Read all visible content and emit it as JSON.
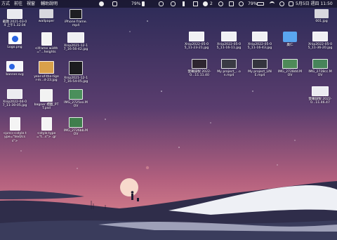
{
  "menubar": {
    "left": [
      "方式",
      "前往",
      "視窗",
      "輔助說明"
    ],
    "battery_a": "79%",
    "battery_b": "79%",
    "notify_count": "2",
    "datetime": "5月5日 週四 11:50"
  },
  "desktop": {
    "files": [
      {
        "label": "截圖 2021-03-04 上午1.32.04",
        "kind": "shot"
      },
      {
        "label": "wallpaper",
        "kind": "blank"
      },
      {
        "label": "iPhone frame.mp4",
        "kind": "phone"
      },
      {
        "label": "Logo.png",
        "kind": "logo"
      },
      {
        "label": "<iframe width=\"...heights",
        "kind": "doc"
      },
      {
        "label": "Xnip2021-12-17_16-56-42.jpg",
        "kind": "shot"
      },
      {
        "label": "banner.svg",
        "kind": "banner"
      },
      {
        "label": "year-of-the-tiger-m...d-23.jpg",
        "kind": "tiger"
      },
      {
        "label": "Xnip2021-12-17_16-54-05.jpg",
        "kind": "shot"
      },
      {
        "label": "Xnip2022-04-07_11-30-05.jpg",
        "kind": "shot"
      },
      {
        "label": "banner 標籤_PTT.psd",
        "kind": "doc"
      },
      {
        "label": "IMG_2725xx.MOV",
        "kind": "video"
      },
      {
        "label": "<pre><style type=\"text/css\">",
        "kind": "doc"
      },
      {
        "label": "<style type=\"t...s\"> .gr",
        "kind": "doc"
      },
      {
        "label": "IMG_2726bb.MOV",
        "kind": "video"
      },
      {
        "label": "001.jpg",
        "kind": "blank"
      },
      {
        "label": "Xnip2022-05-05_11-23-21.jpg",
        "kind": "shot"
      },
      {
        "label": "Xnip2022-05-05_11-16-11.jpg",
        "kind": "shot"
      },
      {
        "label": "Xnip2022-05-05_11-16-43.jpg",
        "kind": "shot"
      },
      {
        "label": "廣仁",
        "kind": "folder"
      },
      {
        "label": "Xnip2022-05-05_11-36-20.jpg",
        "kind": "shot"
      },
      {
        "label": "螢幕錄製 2022-0...11.11.40",
        "kind": "movie"
      },
      {
        "label": "My project_...on.mp4",
        "kind": "movie"
      },
      {
        "label": "My project_LINE.mp4",
        "kind": "movie"
      },
      {
        "label": "IMG_2728dd.MOV",
        "kind": "video"
      },
      {
        "label": "IMG_2728cc.MOV",
        "kind": "video"
      },
      {
        "label": "螢幕錄製 2022-0...11.46.47",
        "kind": "shot"
      }
    ]
  },
  "colors": {
    "sky_top": "#2c2b57",
    "sky_mid": "#8a4f78",
    "sky_horizon": "#e58e93",
    "moon": "#f7d9cc",
    "hill": "#2f2d4a",
    "dune": "#eef0f5"
  }
}
